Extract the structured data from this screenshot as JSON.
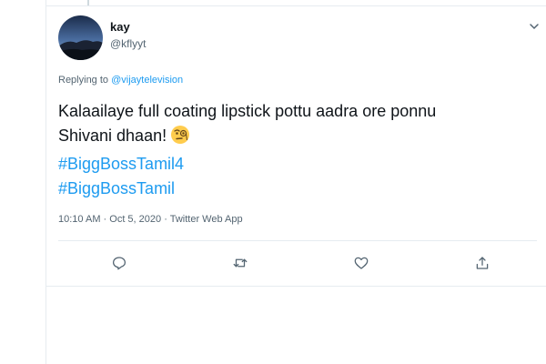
{
  "tweet": {
    "author": {
      "name": "kay",
      "handle": "@kflyyt"
    },
    "replying_prefix": "Replying to ",
    "replying_to": "@vijaytelevision",
    "text_line1": "Kalaailaye full coating lipstick pottu aadra ore ponnu",
    "text_line2": "Shivani dhaan!",
    "emoji": "face-with-monocle",
    "hashtags": [
      "#BiggBossTamil4",
      "#BiggBossTamil"
    ],
    "time": "10:10 AM",
    "date": "Oct 5, 2020",
    "source": "Twitter Web App",
    "separator": " · "
  },
  "colors": {
    "link": "#1d9bf0",
    "muted": "#536471",
    "text": "#0f1419",
    "border": "#e6ecf0"
  },
  "actions": [
    "reply-icon",
    "retweet-icon",
    "like-icon",
    "share-icon"
  ]
}
